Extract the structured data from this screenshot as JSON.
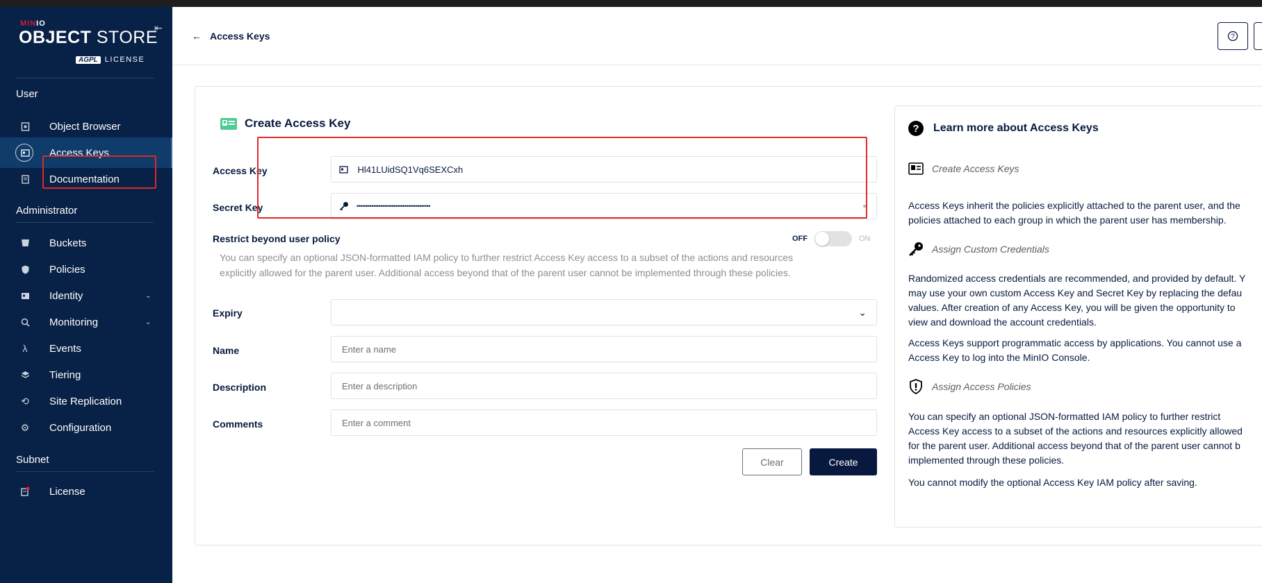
{
  "logo": {
    "brand_prefix": "MIN",
    "brand_suffix": "IO",
    "product_bold": "OBJECT",
    "product_light": "STORE",
    "license_badge": "AGPL",
    "license_text": "LICENSE"
  },
  "sidebar": {
    "sections": [
      "User",
      "Administrator",
      "Subnet"
    ],
    "items": [
      {
        "label": "Object Browser",
        "icon": "object-browser-icon"
      },
      {
        "label": "Access Keys",
        "icon": "access-keys-icon",
        "active": true
      },
      {
        "label": "Documentation",
        "icon": "documentation-icon"
      },
      {
        "label": "Buckets",
        "icon": "buckets-icon"
      },
      {
        "label": "Policies",
        "icon": "policies-icon"
      },
      {
        "label": "Identity",
        "icon": "identity-icon",
        "expandable": true
      },
      {
        "label": "Monitoring",
        "icon": "monitoring-icon",
        "expandable": true
      },
      {
        "label": "Events",
        "icon": "lambda-icon"
      },
      {
        "label": "Tiering",
        "icon": "tiering-icon"
      },
      {
        "label": "Site Replication",
        "icon": "site-replication-icon"
      },
      {
        "label": "Configuration",
        "icon": "gear-icon"
      },
      {
        "label": "License",
        "icon": "license-icon",
        "notification": true
      }
    ]
  },
  "header": {
    "back_label": "Access Keys"
  },
  "form": {
    "title": "Create Access Key",
    "access_key_label": "Access Key",
    "access_key_value": "Hl41LUidSQ1Vq6SEXCxh",
    "secret_key_label": "Secret Key",
    "secret_key_masked": "••••••••••••••••••••••••••••••••••••••••",
    "restrict_label": "Restrict beyond user policy",
    "toggle_off": "OFF",
    "toggle_on": "ON",
    "restrict_help_1": "You can specify an optional JSON-formatted IAM policy to further restrict Access Key access to a subset of the actions and resources",
    "restrict_help_2": "explicitly allowed for the parent user. Additional access beyond that of the parent user cannot be implemented through these policies.",
    "expiry_label": "Expiry",
    "name_label": "Name",
    "name_placeholder": "Enter a name",
    "description_label": "Description",
    "description_placeholder": "Enter a description",
    "comments_label": "Comments",
    "comments_placeholder": "Enter a comment",
    "clear_label": "Clear",
    "create_label": "Create"
  },
  "help_panel": {
    "title": "Learn more about Access Keys",
    "sub1": "Create Access Keys",
    "p1_l1": "Access Keys inherit the policies explicitly attached to the parent user, and the",
    "p1_l2": "policies attached to each group in which the parent user has membership.",
    "sub2": "Assign Custom Credentials",
    "p2_l1": "Randomized access credentials are recommended, and provided by default. Y",
    "p2_l2": "may use your own custom Access Key and Secret Key by replacing the defau",
    "p2_l3": "values. After creation of any Access Key, you will be given the opportunity to",
    "p2_l4": "view and download the account credentials.",
    "p3_l1": "Access Keys support programmatic access by applications. You cannot use a",
    "p3_l2": "Access Key to log into the MinIO Console.",
    "sub3": "Assign Access Policies",
    "p4_l1": "You can specify an optional JSON-formatted IAM policy to further restrict",
    "p4_l2": "Access Key access to a subset of the actions and resources explicitly allowed",
    "p4_l3": "for the parent user. Additional access beyond that of the parent user cannot b",
    "p4_l4": "implemented through these policies.",
    "p5_l1": "You cannot modify the optional Access Key IAM policy after saving."
  },
  "colors": {
    "sidebar_bg": "#082146",
    "primary": "#07193e",
    "highlight_box": "#e0282a",
    "active_item": "#0f3c6b"
  }
}
